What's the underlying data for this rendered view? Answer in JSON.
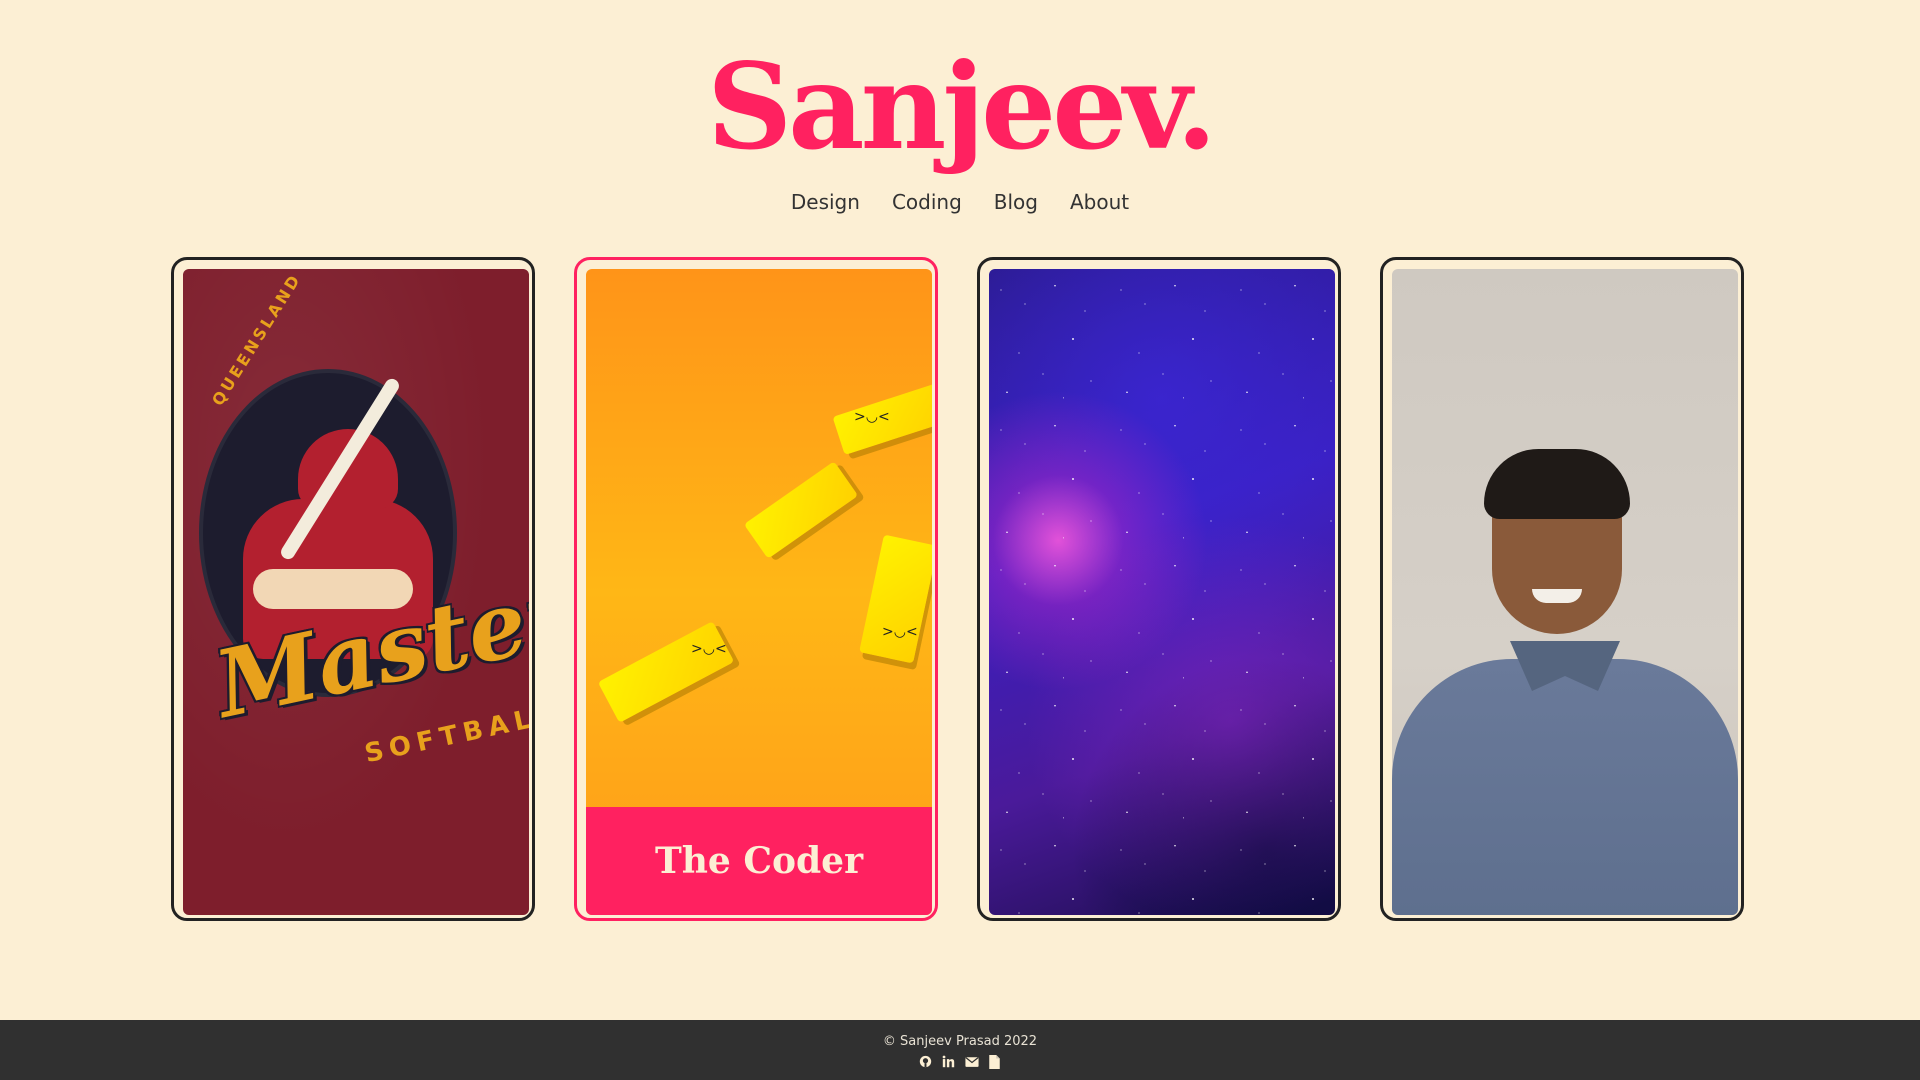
{
  "brand": {
    "logo_text": "Sanjeev.",
    "color": "#ff2160"
  },
  "nav": {
    "items": [
      {
        "label": "Design"
      },
      {
        "label": "Coding"
      },
      {
        "label": "Blog"
      },
      {
        "label": "About"
      }
    ]
  },
  "cards": {
    "softball": {
      "badge_top": "QUEENSLAND",
      "badge_main": "Masters",
      "badge_sub": "SOFTBALL"
    },
    "coder": {
      "caption": "The Coder"
    }
  },
  "footer": {
    "copyright": "© Sanjeev Prasad 2022",
    "icons": [
      "github-icon",
      "linkedin-icon",
      "email-icon",
      "document-icon"
    ]
  },
  "colors": {
    "background": "#fcefd4",
    "accent": "#ff2160",
    "footer_bg": "#303030"
  }
}
